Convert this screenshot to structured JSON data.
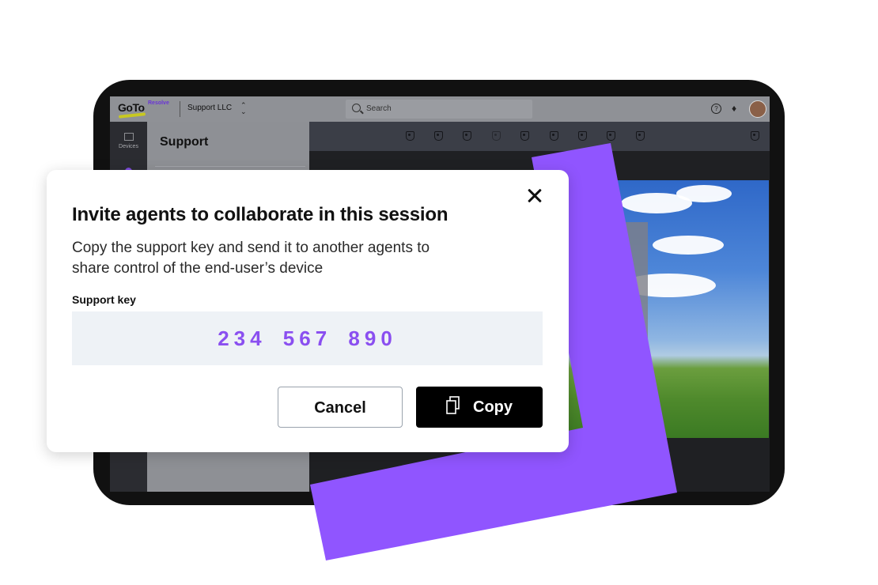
{
  "app": {
    "logo_text": "GoTo",
    "logo_sub": "Resolve",
    "org_name": "Support LLC",
    "org_chevron": "⌃⌄",
    "search_placeholder": "Search",
    "help_icon": "?",
    "bell_icon": "🔔"
  },
  "sidebar": {
    "devices_label": "Devices"
  },
  "panel": {
    "title": "Support"
  },
  "modal": {
    "title": "Invite agents to collaborate in this session",
    "description": "Copy the support key and send it to another agents to share control of the end-user’s device",
    "key_label": "Support key",
    "key_value": "234 567 890",
    "cancel_label": "Cancel",
    "copy_label": "Copy"
  },
  "colors": {
    "accent_purple": "#9055ff",
    "key_text": "#8a4ff0",
    "primary_button": "#000000"
  },
  "icons": [
    "search-icon",
    "help-icon",
    "bell-icon",
    "avatar",
    "devices-icon",
    "shield-user-icon",
    "close-icon",
    "copy-icon"
  ]
}
